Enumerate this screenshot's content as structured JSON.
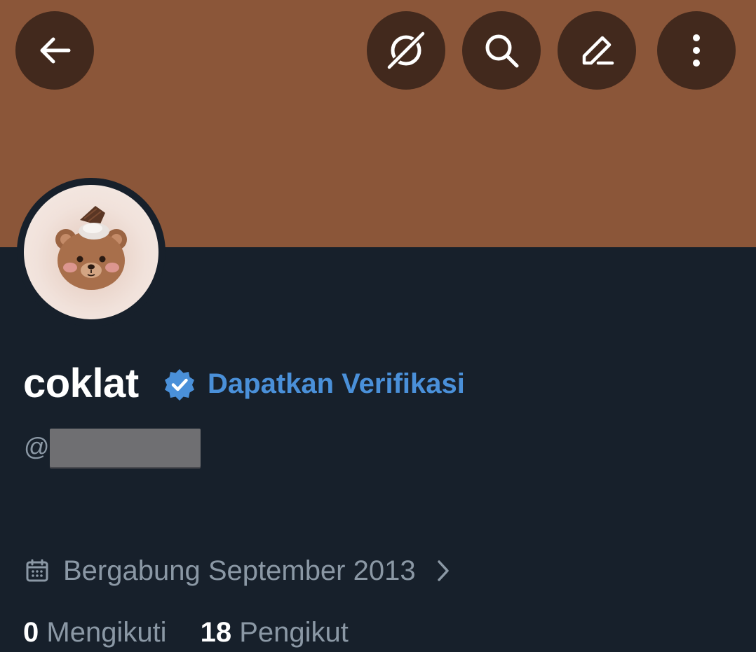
{
  "profile": {
    "display_name": "coklat",
    "get_verified_label": "Dapatkan Verifikasi",
    "handle_prefix": "@",
    "joined": "Bergabung September 2013"
  },
  "stats": {
    "following_count": "0",
    "following_label": "Mengikuti",
    "followers_count": "18",
    "followers_label": "Pengikut"
  },
  "toolbar": {
    "icons": [
      "back-arrow-icon",
      "grok-icon",
      "search-icon",
      "edit-icon",
      "more-vertical-icon"
    ]
  },
  "colors": {
    "banner": "#8b5639",
    "button_bg": "#42291d",
    "background": "#17202b",
    "accent": "#4a90d9",
    "secondary_text": "#8b98a5"
  }
}
